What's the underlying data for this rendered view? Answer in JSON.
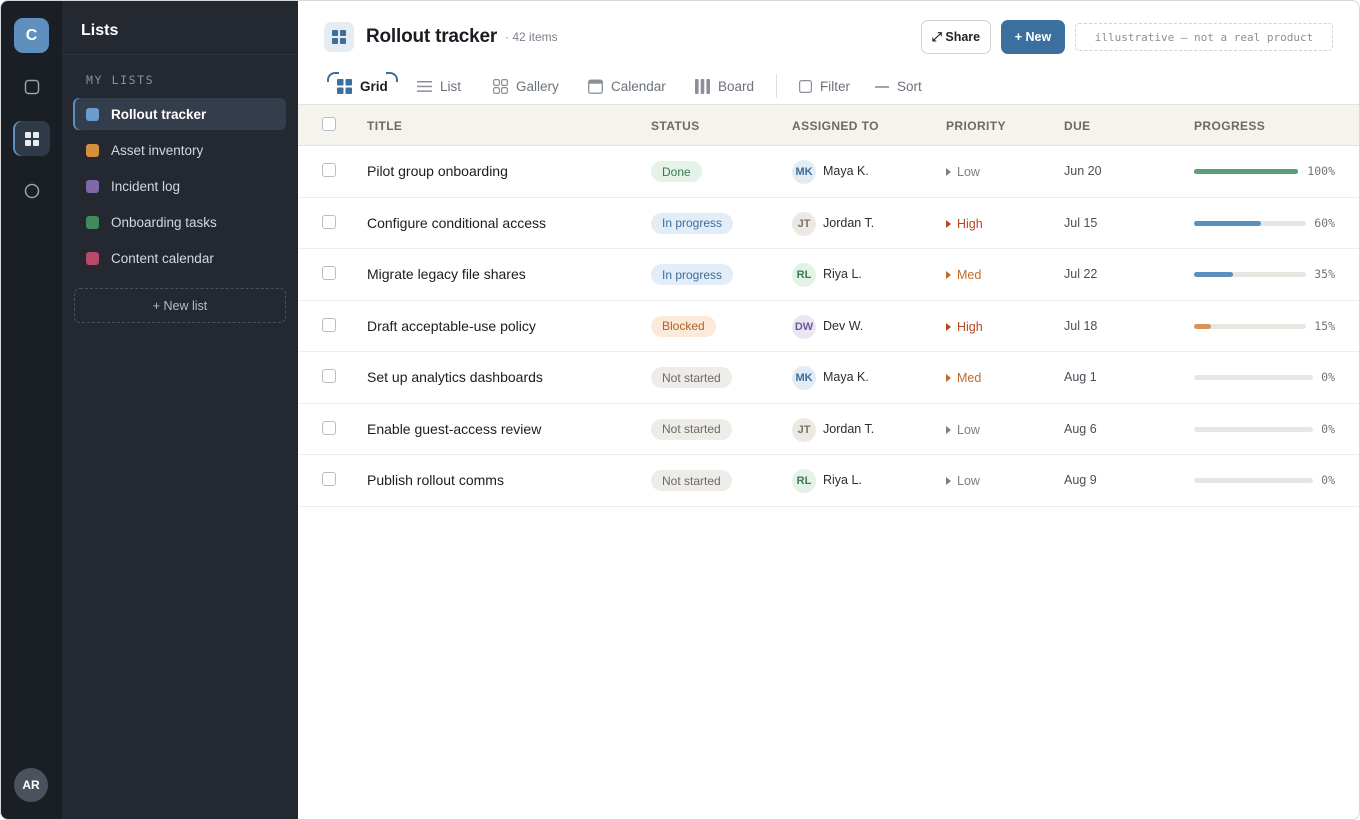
{
  "rail": {
    "logo_letter": "C",
    "items": [
      {
        "icon": "square-icon"
      },
      {
        "icon": "grid-icon",
        "active": true
      },
      {
        "icon": "circle-icon"
      }
    ],
    "user_initials": "AR"
  },
  "sidebar": {
    "title": "Lists",
    "section_label": "MY LISTS",
    "items": [
      {
        "label": "Rollout tracker",
        "color": "#6b9ccd"
      },
      {
        "label": "Asset inventory",
        "color": "#d68f3e"
      },
      {
        "label": "Incident log",
        "color": "#7e68a8"
      },
      {
        "label": "Onboarding tasks",
        "color": "#3f8a5e"
      },
      {
        "label": "Content calendar",
        "color": "#b8496a"
      }
    ],
    "new_list_label": "+ New list"
  },
  "header": {
    "title": "Rollout tracker",
    "item_count": "· 42 items",
    "share_label": "⤢ Share",
    "new_label": "+ New",
    "disclaimer": "illustrative — not a real product"
  },
  "views": {
    "tabs": [
      {
        "label": "Grid",
        "icon": "grid-icon",
        "active": true
      },
      {
        "label": "List",
        "icon": "list-icon"
      },
      {
        "label": "Gallery",
        "icon": "gallery-icon"
      },
      {
        "label": "Calendar",
        "icon": "calendar-icon"
      },
      {
        "label": "Board",
        "icon": "board-icon"
      }
    ],
    "filter_label": "Filter",
    "sort_label": "Sort"
  },
  "table": {
    "columns": {
      "title": "TITLE",
      "status": "STATUS",
      "assigned": "ASSIGNED TO",
      "priority": "PRIORITY",
      "due": "DUE",
      "progress": "PROGRESS"
    },
    "rows": [
      {
        "title": "Pilot group onboarding",
        "status": "Done",
        "initials": "MK",
        "assignee": "Maya K.",
        "priority": "Low",
        "due": "Jun 20",
        "progress": 100,
        "progress_label": "100%"
      },
      {
        "title": "Configure conditional access",
        "status": "In progress",
        "initials": "JT",
        "assignee": "Jordan T.",
        "priority": "High",
        "due": "Jul 15",
        "progress": 60,
        "progress_label": "60%"
      },
      {
        "title": "Migrate legacy file shares",
        "status": "In progress",
        "initials": "RL",
        "assignee": "Riya L.",
        "priority": "Med",
        "due": "Jul 22",
        "progress": 35,
        "progress_label": "35%"
      },
      {
        "title": "Draft acceptable-use policy",
        "status": "Blocked",
        "initials": "DW",
        "assignee": "Dev W.",
        "priority": "High",
        "due": "Jul 18",
        "progress": 15,
        "progress_label": "15%"
      },
      {
        "title": "Set up analytics dashboards",
        "status": "Not started",
        "initials": "MK",
        "assignee": "Maya K.",
        "priority": "Med",
        "due": "Aug 1",
        "progress": 0,
        "progress_label": "0%"
      },
      {
        "title": "Enable guest-access review",
        "status": "Not started",
        "initials": "JT",
        "assignee": "Jordan T.",
        "priority": "Low",
        "due": "Aug 6",
        "progress": 0,
        "progress_label": "0%"
      },
      {
        "title": "Publish rollout comms",
        "status": "Not started",
        "initials": "RL",
        "assignee": "Riya L.",
        "priority": "Low",
        "due": "Aug 9",
        "progress": 0,
        "progress_label": "0%"
      }
    ]
  },
  "colors": {
    "accent": "#3a6f9e",
    "status_done_bg": "#e4f2e8",
    "status_done_fg": "#3b7a52",
    "status_progress_bg": "#e2edf8",
    "status_progress_fg": "#3c6d9c",
    "status_blocked_bg": "#fbe9da",
    "status_blocked_fg": "#b0612c",
    "status_not_started_bg": "#eeece8",
    "status_not_started_fg": "#6e6a63",
    "priority_low": "#7a7f86",
    "priority_med": "#c26a2a",
    "priority_high": "#b8461f",
    "progress_done": "#5aa074",
    "progress_active": "#5b8fbe",
    "progress_blocked": "#d9925a"
  }
}
